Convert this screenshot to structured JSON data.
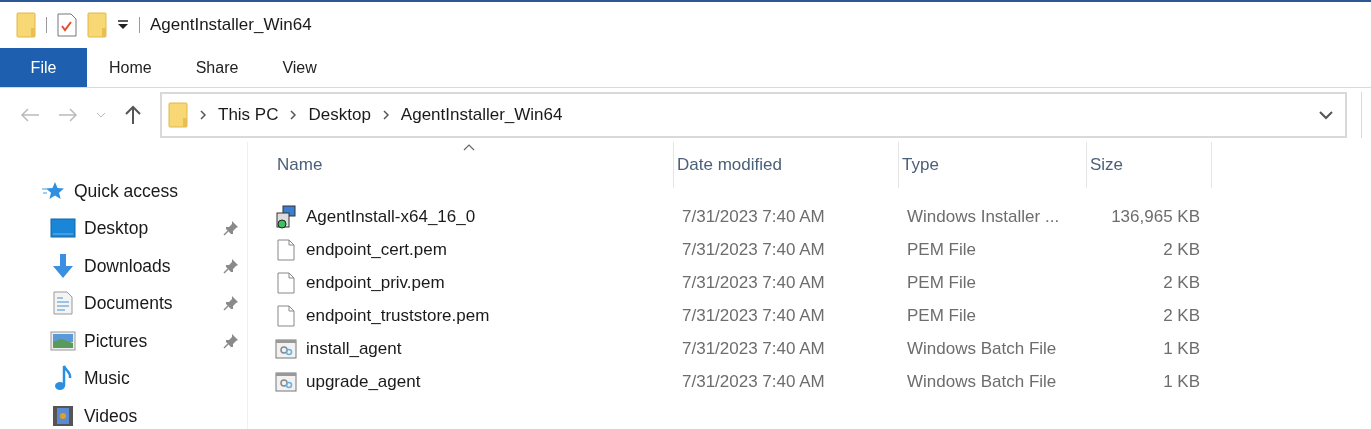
{
  "window": {
    "title": "AgentInstaller_Win64"
  },
  "tabs": [
    {
      "label": "File",
      "selected": true
    },
    {
      "label": "Home",
      "selected": false
    },
    {
      "label": "Share",
      "selected": false
    },
    {
      "label": "View",
      "selected": false
    }
  ],
  "address": {
    "crumbs": [
      "This PC",
      "Desktop",
      "AgentInstaller_Win64"
    ]
  },
  "sidebar": {
    "items": [
      {
        "label": "Quick access",
        "kind": "star",
        "pinned": false
      },
      {
        "label": "Desktop",
        "kind": "desktop",
        "pinned": true
      },
      {
        "label": "Downloads",
        "kind": "download",
        "pinned": true
      },
      {
        "label": "Documents",
        "kind": "document",
        "pinned": true
      },
      {
        "label": "Pictures",
        "kind": "pictures",
        "pinned": true
      },
      {
        "label": "Music",
        "kind": "music",
        "pinned": false
      },
      {
        "label": "Videos",
        "kind": "videos",
        "pinned": false
      }
    ]
  },
  "table": {
    "columns": [
      "Name",
      "Date modified",
      "Type",
      "Size"
    ],
    "rows": [
      {
        "kind": "installer",
        "name": "AgentInstall-x64_16_0",
        "date": "7/31/2023 7:40 AM",
        "type": "Windows Installer ...",
        "size": "136,965 KB"
      },
      {
        "kind": "file",
        "name": "endpoint_cert.pem",
        "date": "7/31/2023 7:40 AM",
        "type": "PEM File",
        "size": "2 KB"
      },
      {
        "kind": "file",
        "name": "endpoint_priv.pem",
        "date": "7/31/2023 7:40 AM",
        "type": "PEM File",
        "size": "2 KB"
      },
      {
        "kind": "file",
        "name": "endpoint_truststore.pem",
        "date": "7/31/2023 7:40 AM",
        "type": "PEM File",
        "size": "2 KB"
      },
      {
        "kind": "batch",
        "name": "install_agent",
        "date": "7/31/2023 7:40 AM",
        "type": "Windows Batch File",
        "size": "1 KB"
      },
      {
        "kind": "batch",
        "name": "upgrade_agent",
        "date": "7/31/2023 7:40 AM",
        "type": "Windows Batch File",
        "size": "1 KB"
      }
    ]
  }
}
